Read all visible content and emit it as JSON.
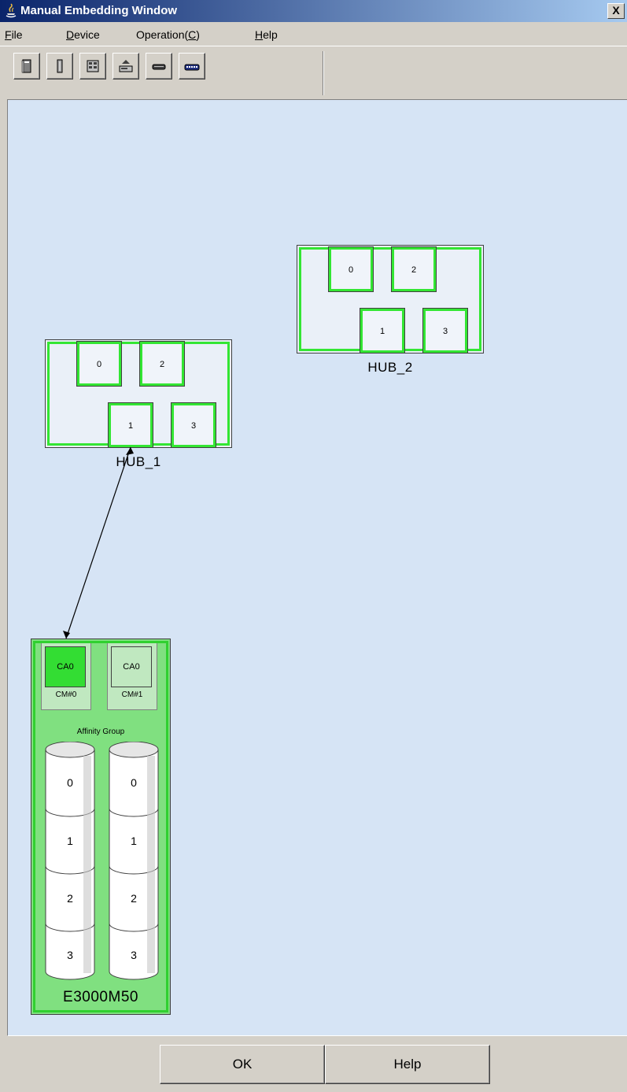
{
  "window": {
    "title": "Manual Embedding Window",
    "close_glyph": "X"
  },
  "menu": [
    {
      "pre": "",
      "mnemonic": "F",
      "post": "ile"
    },
    {
      "pre": "",
      "mnemonic": "D",
      "post": "evice"
    },
    {
      "pre": "Operation(",
      "mnemonic": "C",
      "post": ")"
    },
    {
      "pre": "",
      "mnemonic": "H",
      "post": "elp"
    }
  ],
  "toolbar": {
    "buttons": [
      "tower-server-icon",
      "narrow-server-icon",
      "rack-storage-icon",
      "eject-drive-icon",
      "tape-drive-icon",
      "switch-icon"
    ]
  },
  "hubs": [
    {
      "name": "HUB_1",
      "ports": [
        "0",
        "2",
        "1",
        "3"
      ]
    },
    {
      "name": "HUB_2",
      "ports": [
        "0",
        "2",
        "1",
        "3"
      ]
    }
  ],
  "storage": {
    "name": "E3000M50",
    "modules": [
      {
        "ca": "CA0",
        "cm": "CM#0",
        "active": true
      },
      {
        "ca": "CA0",
        "cm": "CM#1",
        "active": false
      }
    ],
    "affinity_label": "Affinity Group",
    "volumes": [
      "0",
      "1",
      "2",
      "3"
    ]
  },
  "connection": {
    "from": "HUB_1 port 1",
    "to": "CM#0 CA0"
  },
  "colors": {
    "active_green": "#33e633",
    "canvas": "#d6e4f5",
    "storage_fill": "#80e080",
    "title_start": "#0a246a"
  },
  "buttons": {
    "ok": "OK",
    "help": "Help"
  }
}
